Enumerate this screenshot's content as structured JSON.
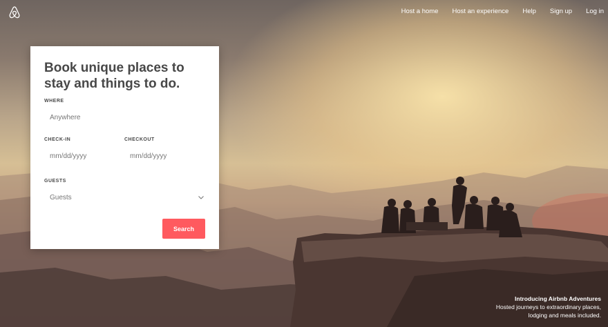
{
  "nav": {
    "links": [
      "Host a home",
      "Host an experience",
      "Help",
      "Sign up",
      "Log in"
    ]
  },
  "search_card": {
    "headline": "Book unique places to stay and things to do.",
    "where": {
      "label": "WHERE",
      "placeholder": "Anywhere"
    },
    "check_in": {
      "label": "CHECK-IN",
      "placeholder": "mm/dd/yyyy"
    },
    "checkout": {
      "label": "CHECKOUT",
      "placeholder": "mm/dd/yyyy"
    },
    "guests": {
      "label": "GUESTS",
      "value": "Guests"
    },
    "search_button": "Search"
  },
  "caption": {
    "title": "Introducing Airbnb Adventures",
    "line1": "Hosted journeys to extraordinary places,",
    "line2": "lodging and meals included."
  },
  "icons": {
    "logo": "airbnb-logo-icon",
    "chevron": "chevron-down-icon"
  },
  "colors": {
    "brand": "#ff5a5f",
    "text_dark": "#484848",
    "text_muted": "#767676"
  }
}
